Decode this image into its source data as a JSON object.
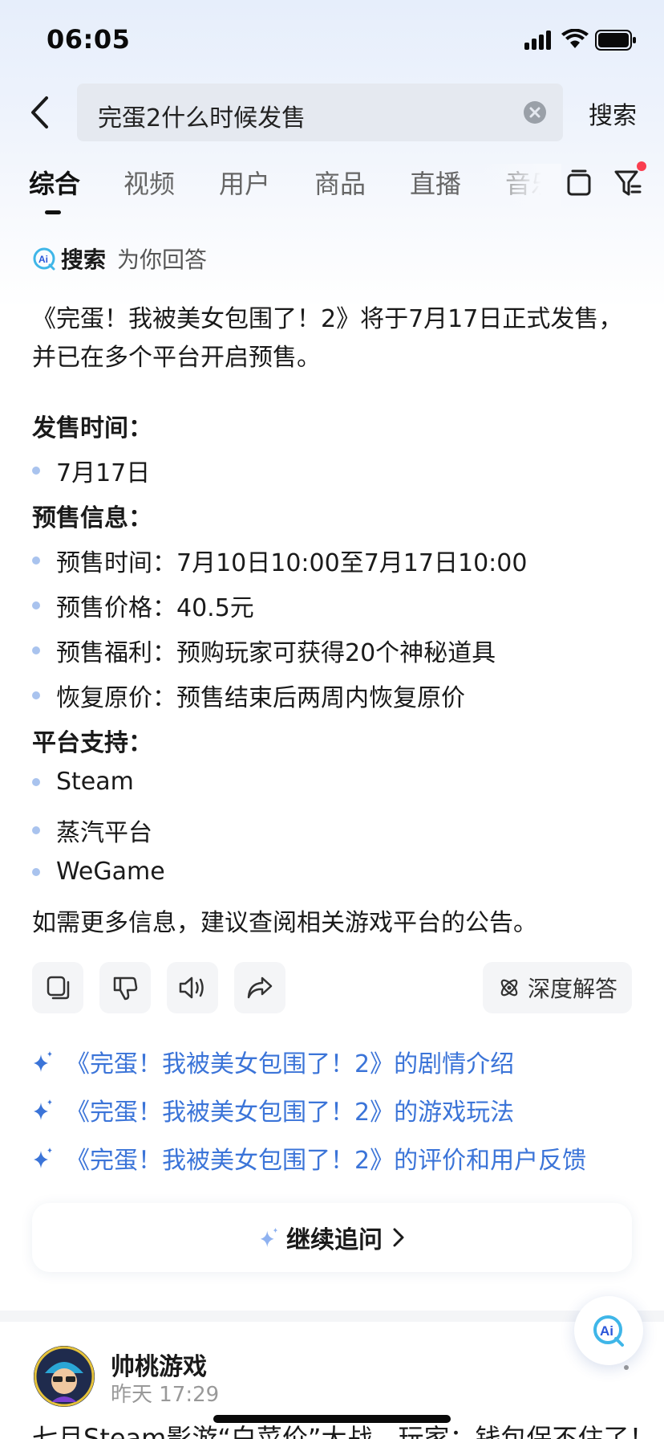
{
  "status_bar": {
    "time": "06:05"
  },
  "search": {
    "query": "完蛋2什么时候发售",
    "button_label": "搜索"
  },
  "tabs": [
    {
      "label": "综合",
      "active": true
    },
    {
      "label": "视频"
    },
    {
      "label": "用户"
    },
    {
      "label": "商品"
    },
    {
      "label": "直播"
    },
    {
      "label": "音乐"
    }
  ],
  "ai_answer": {
    "header_bold": "搜索",
    "header_sub": "为你回答",
    "intro_line1": "《完蛋！我被美女包围了！2》将于7月17日正式发售，",
    "intro_line2": "并已在多个平台开启预售。",
    "sections": {
      "release": {
        "title": "发售时间：",
        "items": [
          "7月17日"
        ]
      },
      "presale": {
        "title": "预售信息：",
        "items": [
          "预售时间：7月10日10:00至7月17日10:00",
          "预售价格：40.5元",
          "预售福利：预购玩家可获得20个神秘道具",
          "恢复原价：预售结束后两周内恢复原价"
        ]
      },
      "platforms": {
        "title": "平台支持：",
        "items": [
          "Steam",
          "蒸汽平台",
          "WeGame"
        ]
      }
    },
    "closing": "如需更多信息，建议查阅相关游戏平台的公告。",
    "deep_answer_label": "深度解答",
    "suggestions": [
      "《完蛋！我被美女包围了！2》的剧情介绍",
      "《完蛋！我被美女包围了！2》的游戏玩法",
      "《完蛋！我被美女包围了！2》的评价和用户反馈"
    ],
    "continue_label": "继续追问"
  },
  "post": {
    "author": "帅桃游戏",
    "time": "昨天 17:29",
    "title": "七月Steam影游“白菜价”大战，玩家：钱包保不住了！"
  },
  "colors": {
    "accent_blue": "#3b74d8",
    "bullet_dot": "#a9c3ee",
    "notification_red": "#fa3e4f"
  }
}
